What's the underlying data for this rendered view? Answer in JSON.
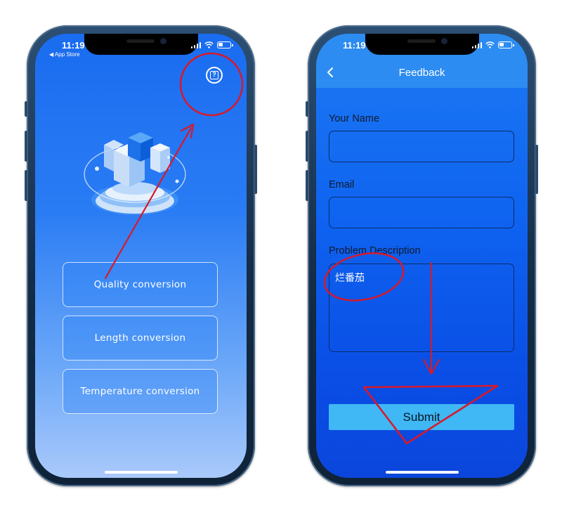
{
  "left_screen": {
    "status_time": "11:19",
    "back_to_app": "◀ App Store",
    "help_icon_glyph": "?",
    "menu_buttons": [
      {
        "label": "Quality conversion"
      },
      {
        "label": "Length conversion"
      },
      {
        "label": "Temperature conversion"
      }
    ]
  },
  "right_screen": {
    "status_time": "11:19",
    "nav_title": "Feedback",
    "fields": {
      "name_label": "Your Name",
      "name_value": "",
      "email_label": "Email",
      "email_value": "",
      "description_label": "Problem Description",
      "description_value": "烂番茄"
    },
    "submit_label": "Submit"
  },
  "colors": {
    "annotation": "#d8192a",
    "submit_button": "#3fb8f5",
    "navbar": "#2c8cf2"
  }
}
